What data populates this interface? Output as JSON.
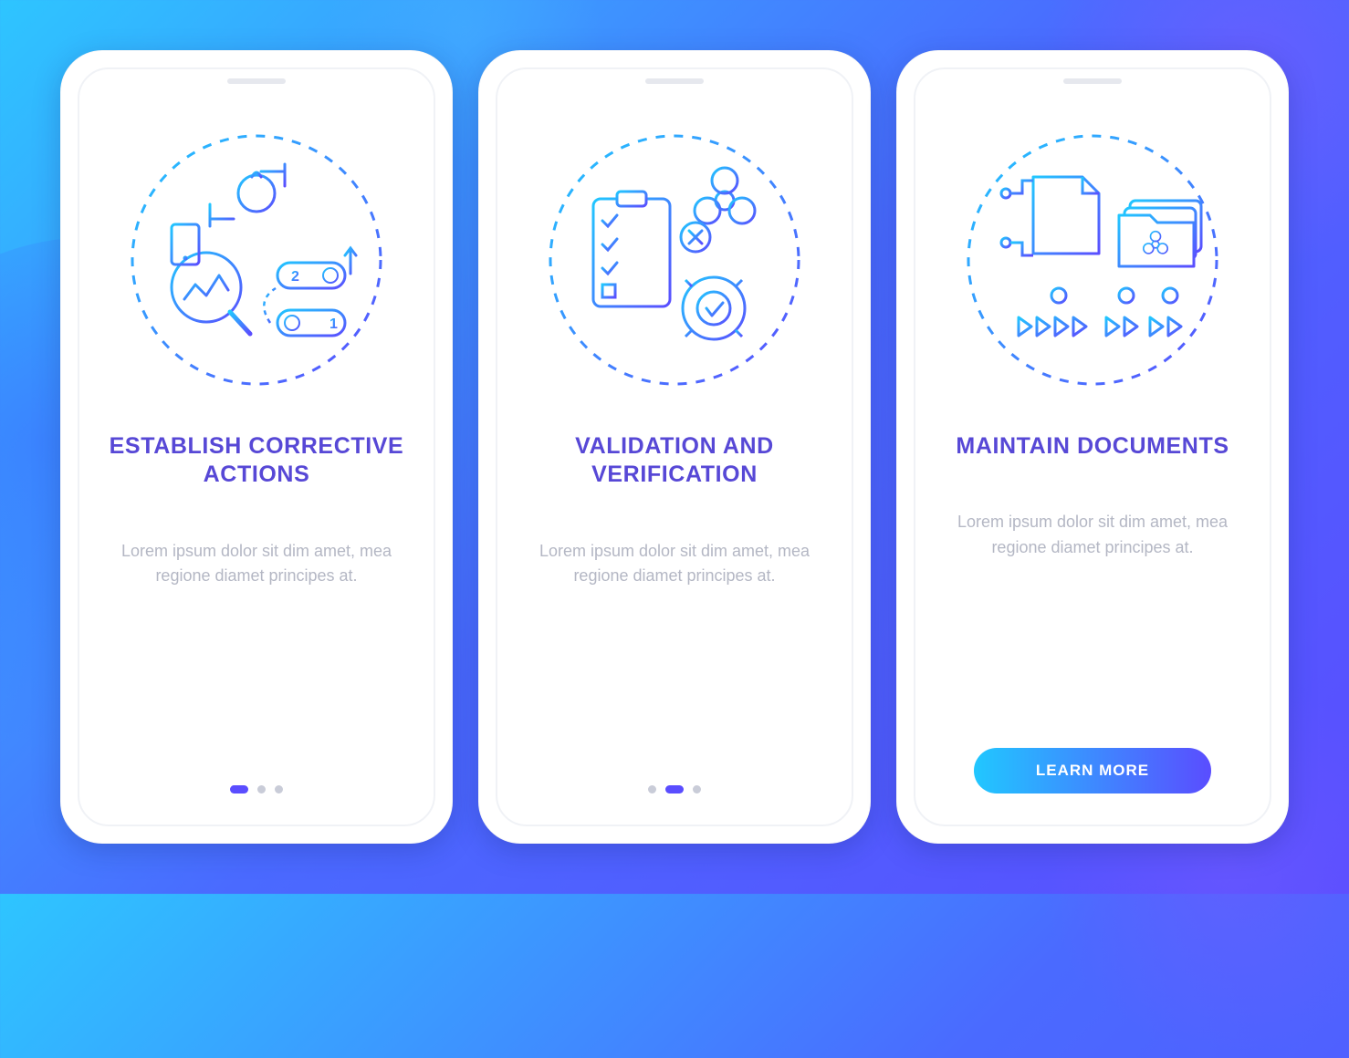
{
  "colors": {
    "title": "#5748d6",
    "body": "#b4b7c4",
    "dot_inactive": "#c9ccd8",
    "dot_active": "#5a4dff",
    "cta_gradient_from": "#21c7ff",
    "cta_gradient_to": "#5a4dff",
    "background_gradient": [
      "#2ec5ff",
      "#4a6aff",
      "#5a4dff"
    ]
  },
  "screens": [
    {
      "icon": "corrective-actions-icon",
      "title": "ESTABLISH CORRECTIVE ACTIONS",
      "body": "Lorem ipsum dolor sit dim amet, mea regione diamet principes at.",
      "active_dot_index": 0,
      "dot_count": 3,
      "has_cta": false
    },
    {
      "icon": "validation-verification-icon",
      "title": "VALIDATION AND VERIFICATION",
      "body": "Lorem ipsum dolor sit dim amet, mea regione diamet principes at.",
      "active_dot_index": 1,
      "dot_count": 3,
      "has_cta": false
    },
    {
      "icon": "maintain-documents-icon",
      "title": "MAINTAIN DOCUMENTS",
      "body": "Lorem ipsum dolor sit dim amet, mea regione diamet principes at.",
      "active_dot_index": 2,
      "dot_count": 3,
      "has_cta": true,
      "cta_label": "LEARN MORE"
    }
  ]
}
